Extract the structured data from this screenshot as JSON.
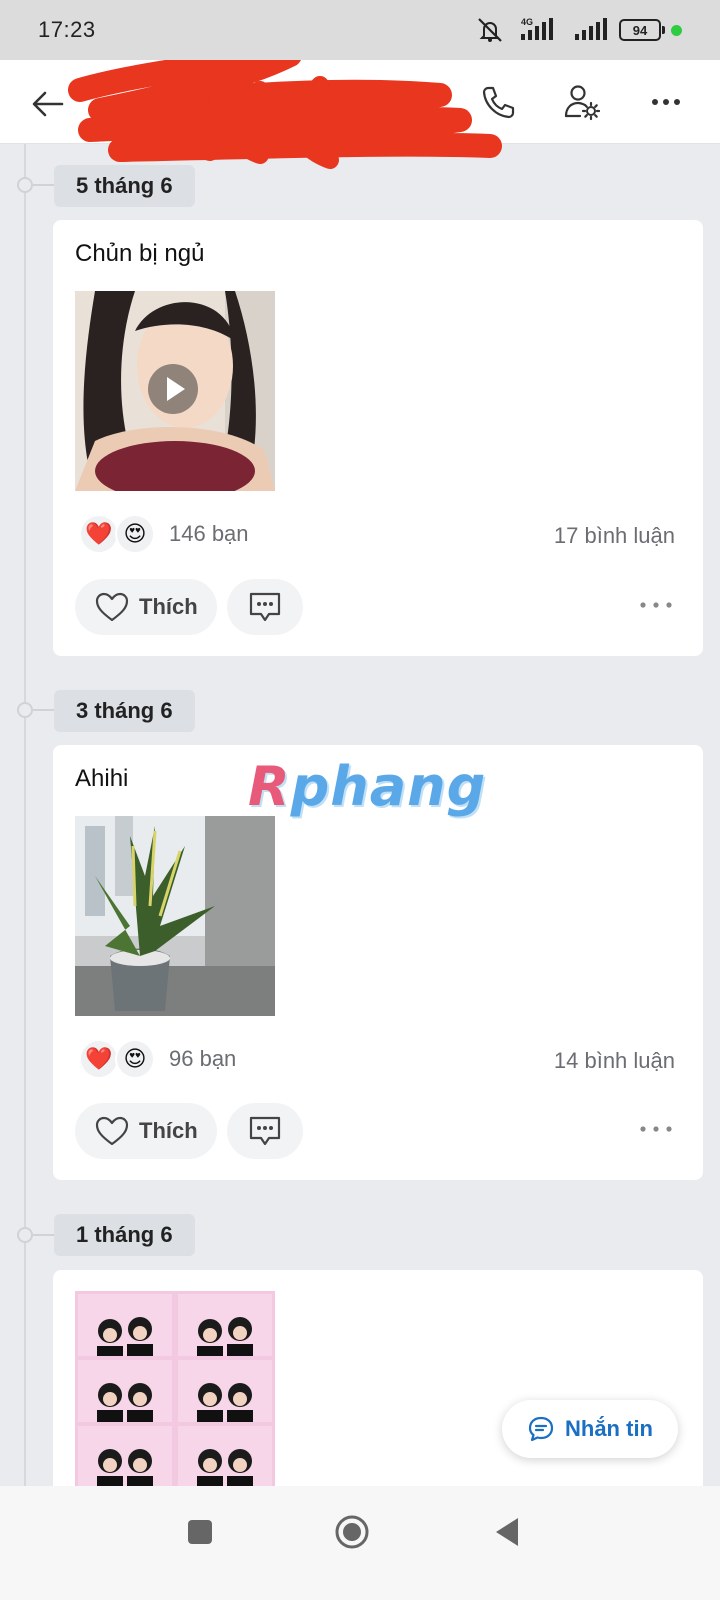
{
  "status_bar": {
    "time": "17:23",
    "network": "4G",
    "battery": "94",
    "icons": [
      "mute-icon",
      "signal-icon",
      "signal-icon-2",
      "battery-icon"
    ]
  },
  "header": {
    "back_icon": "back-arrow-icon",
    "title_redacted": true,
    "call_icon": "phone-icon",
    "settings_icon": "user-settings-icon",
    "more_icon": "more-horizontal-icon"
  },
  "posts": [
    {
      "date": "5 tháng 6",
      "text": "Chủn bị ngủ",
      "media": "video",
      "reaction_icons": [
        "❤️",
        "😍"
      ],
      "reaction_count": "146 bạn",
      "comment_count": "17 bình luận",
      "like_label": "Thích"
    },
    {
      "date": "3 tháng 6",
      "text": "Ahihi",
      "media": "photo",
      "reaction_icons": [
        "❤️",
        "😍"
      ],
      "reaction_count": "96 bạn",
      "comment_count": "14 bình luận",
      "like_label": "Thích"
    },
    {
      "date": "1 tháng 6",
      "text": "",
      "media": "photo-collage"
    }
  ],
  "watermark": {
    "first": "R",
    "rest": "phang"
  },
  "fab": {
    "label": "Nhắn tin",
    "icon": "chat-bubble-icon"
  },
  "nav": [
    "recent-apps-icon",
    "home-icon",
    "back-icon"
  ]
}
